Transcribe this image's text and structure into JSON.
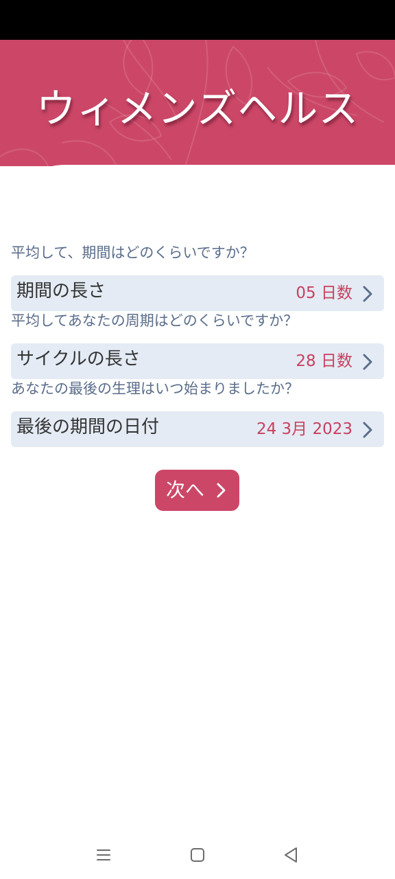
{
  "header": {
    "title": "ウィメンズヘルス"
  },
  "form": {
    "period_question": "平均して、期間はどのくらいですか？",
    "period_length": {
      "label": "期間の長さ",
      "value": "05 日数"
    },
    "cycle_question": "平均してあなたの周期はどのくらいですか？",
    "cycle_length": {
      "label": "サイクルの長さ",
      "value": "28 日数"
    },
    "last_period_question": "あなたの最後の生理はいつ始まりましたか？",
    "last_period_date": {
      "label": "最後の期間の日付",
      "value": "24 3月 2023"
    }
  },
  "next_button": {
    "label": "次へ"
  },
  "nav": {
    "menu_icon": "menu-icon",
    "home_icon": "home-icon",
    "back_icon": "back-icon"
  },
  "colors": {
    "brand": "#cc4767",
    "value_text": "#c9405f",
    "row_background": "#e4ebf4",
    "question_text": "#5a6d8b"
  }
}
